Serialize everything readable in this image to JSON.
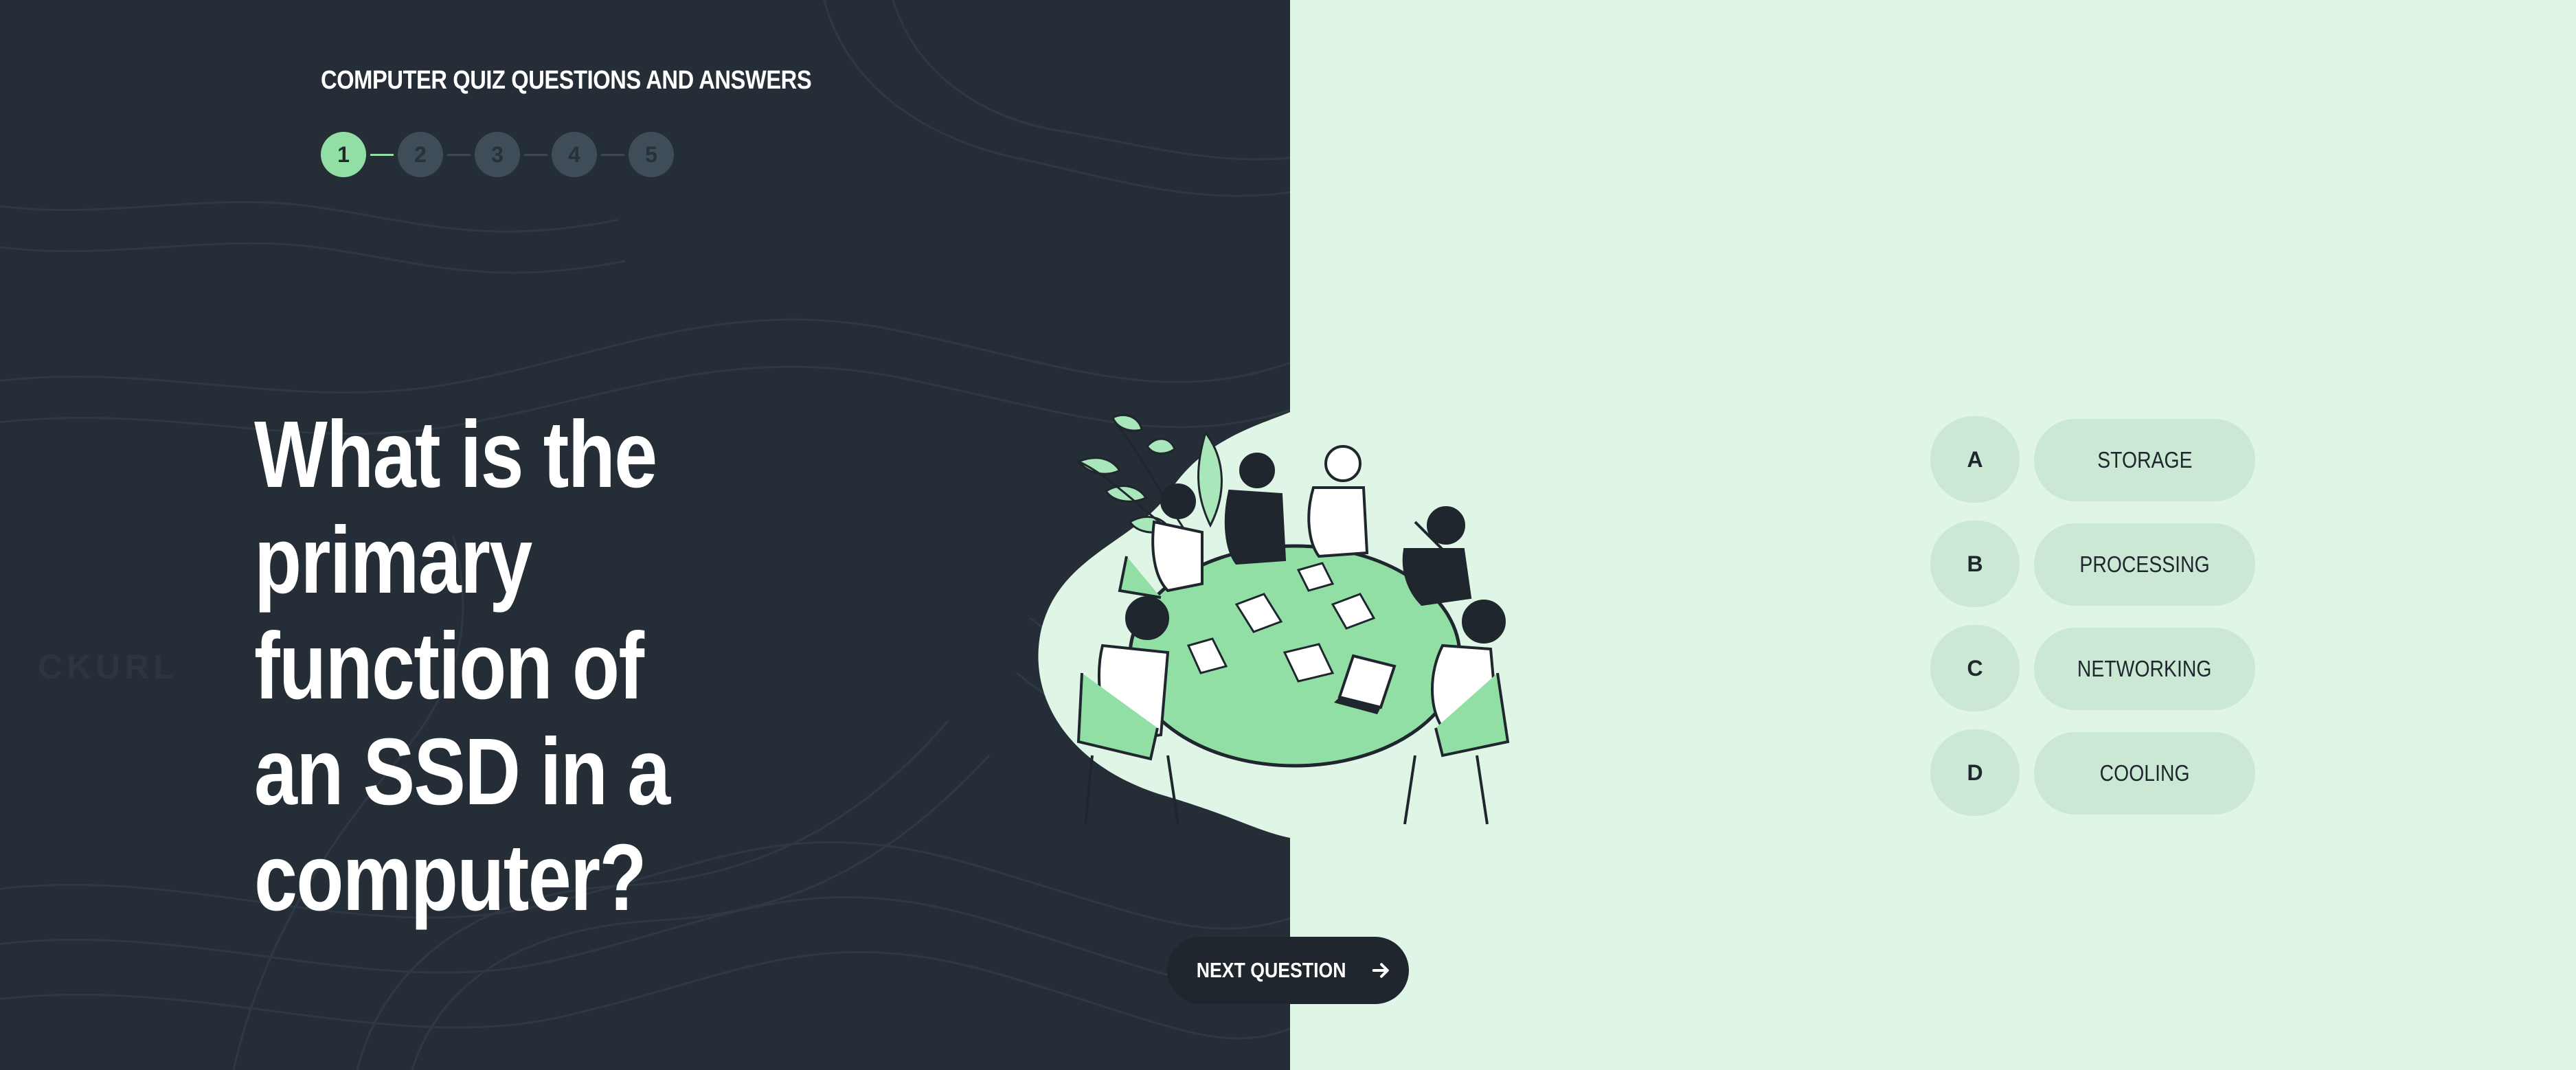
{
  "header": {
    "title": "COMPUTER QUIZ QUESTIONS AND ANSWERS"
  },
  "steps": [
    {
      "number": "1",
      "active": true
    },
    {
      "number": "2",
      "active": false
    },
    {
      "number": "3",
      "active": false
    },
    {
      "number": "4",
      "active": false
    },
    {
      "number": "5",
      "active": false
    }
  ],
  "question": {
    "text": "What is the primary function of an SSD in a computer?"
  },
  "answers": [
    {
      "letter": "A",
      "label": "STORAGE"
    },
    {
      "letter": "B",
      "label": "PROCESSING"
    },
    {
      "letter": "C",
      "label": "NETWORKING"
    },
    {
      "letter": "D",
      "label": "COOLING"
    }
  ],
  "navigation": {
    "next_label": "NEXT QUESTION"
  },
  "background": {
    "faded_text": "CKURL"
  },
  "colors": {
    "dark_panel": "#252d37",
    "accent_green": "#92dfa6",
    "light_panel": "#dff5e6",
    "answer_pill": "#cbe8d4",
    "button_dark": "#1f262e"
  },
  "icons": {
    "next": "arrow-right-icon",
    "illustration": "team-meeting-illustration"
  }
}
